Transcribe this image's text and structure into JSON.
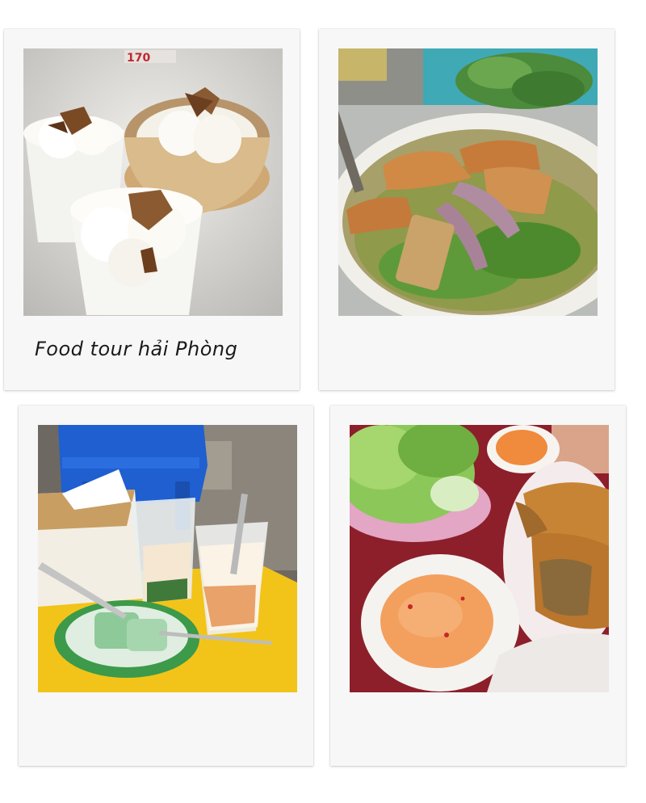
{
  "collage": {
    "caption": "Food tour hải Phòng",
    "photos": [
      {
        "subject": "coconut-ice-cream",
        "sign_text": "170"
      },
      {
        "subject": "mantis-shrimp-fish-noodle-soup"
      },
      {
        "subject": "vietnamese-che-dessert"
      },
      {
        "subject": "banh-da-cua-with-dipping-sauce"
      }
    ]
  }
}
